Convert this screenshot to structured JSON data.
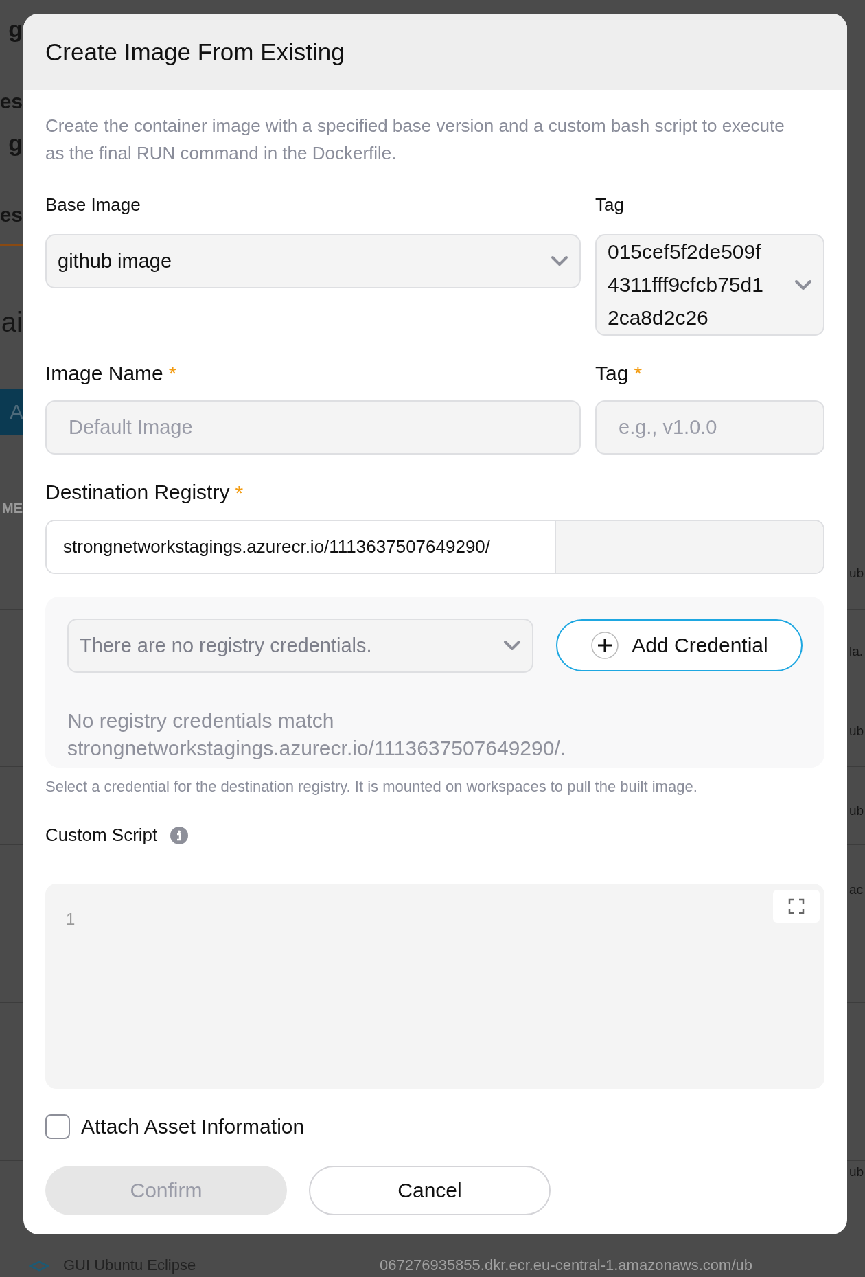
{
  "backdrop": {
    "left_texts": [
      {
        "kind": "heading",
        "text": "g"
      },
      {
        "kind": "tab",
        "text": "es"
      },
      {
        "kind": "heading",
        "text": "g"
      },
      {
        "kind": "tab",
        "text": "es"
      },
      {
        "kind": "title",
        "text": "ai"
      },
      {
        "kind": "button",
        "text": "A"
      },
      {
        "kind": "column",
        "text": "ME"
      }
    ],
    "right_texts": [
      "ub",
      "la.",
      "ub",
      "ub",
      "ac",
      "ub"
    ],
    "bottom_row": {
      "name": "GUI Ubuntu Eclipse",
      "registry": "067276935855.dkr.ecr.eu-central-1.amazonaws.com/ub"
    }
  },
  "dialog": {
    "title": "Create Image From Existing",
    "description": "Create the container image with a specified base version and a custom bash script to execute as the final RUN command in the Dockerfile.",
    "base_image": {
      "label": "Base Image",
      "value": "github image"
    },
    "base_tag": {
      "label": "Tag",
      "value": "015cef5f2de509f4311fff9cfcb75d12ca8d2c26"
    },
    "image_name": {
      "label": "Image Name",
      "required_mark": "*",
      "placeholder": "Default Image"
    },
    "image_tag": {
      "label": "Tag",
      "required_mark": "*",
      "placeholder": "e.g., v1.0.0"
    },
    "destination": {
      "label": "Destination Registry",
      "required_mark": "*",
      "prefix": "strongnetworkstagings.azurecr.io/1113637507649290/"
    },
    "credentials": {
      "select": "There are no registry credentials.",
      "add_button": "Add Credential",
      "message": "No registry credentials match strongnetworkstagings.azurecr.io/1113637507649290/."
    },
    "helper": "Select a credential for the destination registry. It is mounted on workspaces to pull the built image.",
    "script": {
      "label": "Custom Script",
      "line_numbers": [
        "1"
      ]
    },
    "attach_asset": {
      "label": "Attach Asset Information",
      "checked": false
    },
    "buttons": [
      {
        "kind": "primary",
        "label": "Confirm",
        "disabled": true
      },
      {
        "kind": "secondary",
        "label": "Cancel",
        "disabled": false
      }
    ]
  }
}
